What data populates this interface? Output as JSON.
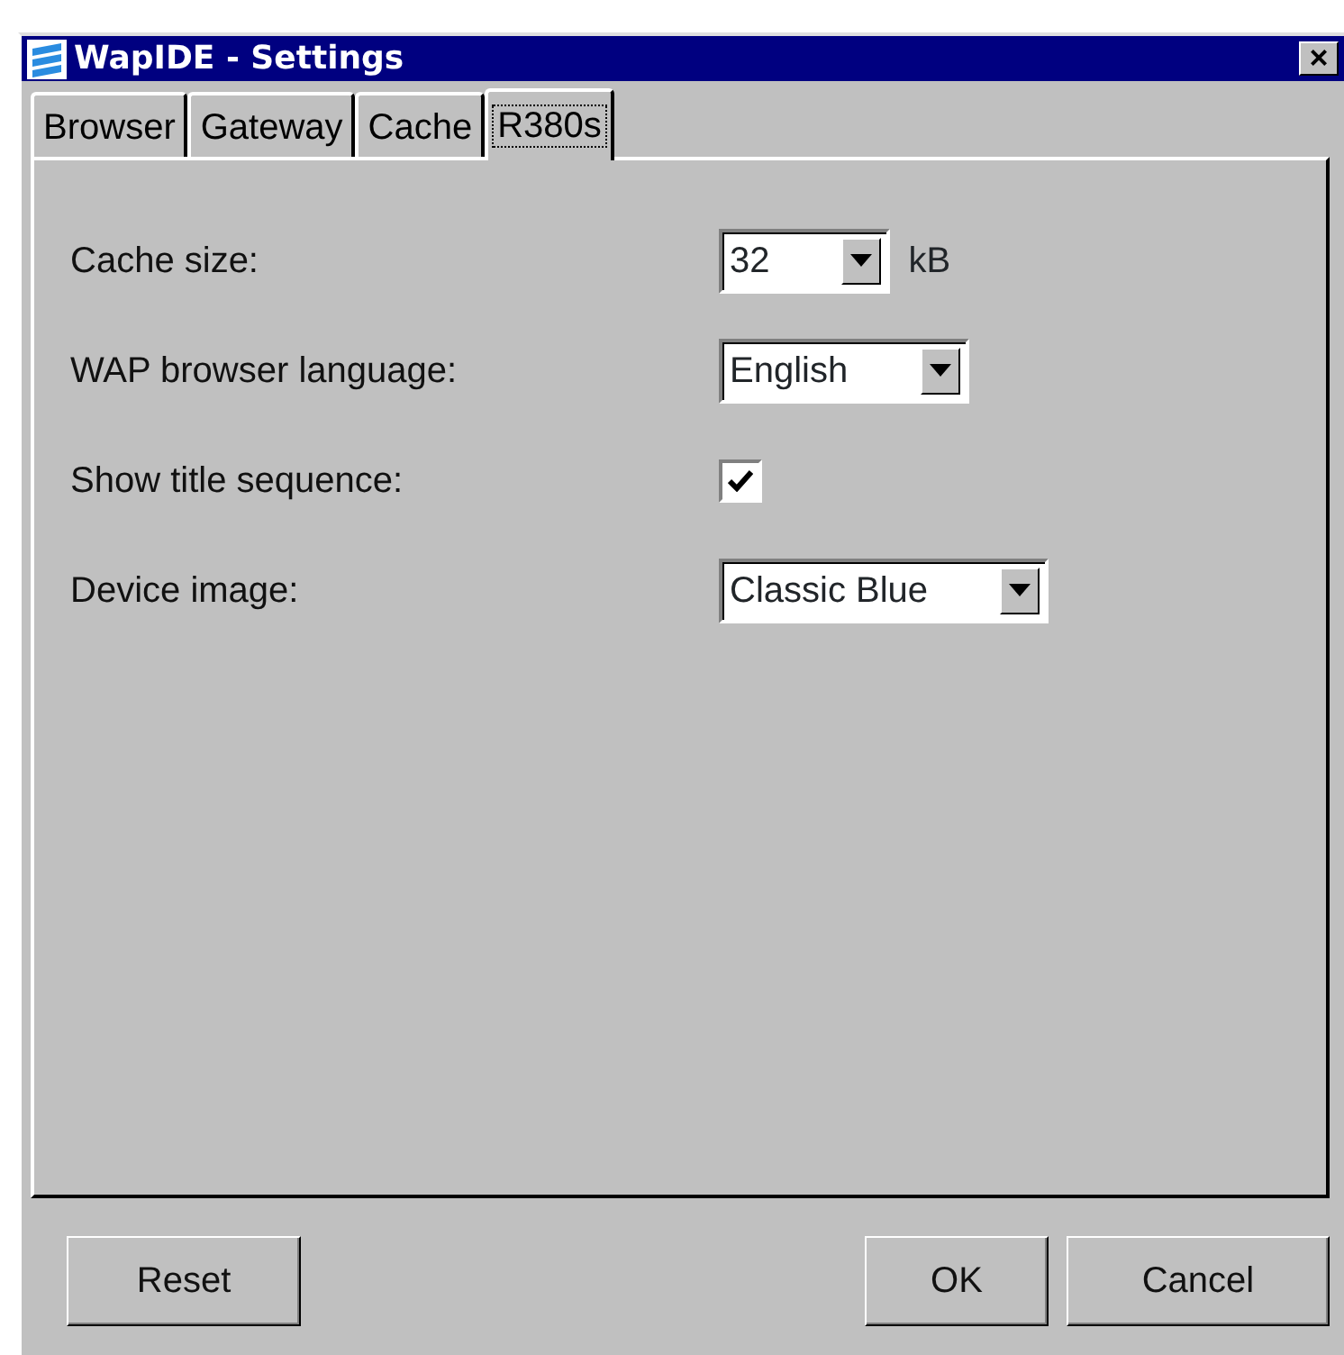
{
  "window": {
    "title": "WapIDE - Settings",
    "close": "×"
  },
  "tabs": [
    {
      "label": "Browser",
      "selected": false
    },
    {
      "label": "Gateway",
      "selected": false
    },
    {
      "label": "Cache",
      "selected": false
    },
    {
      "label": "R380s",
      "selected": true
    }
  ],
  "settings": [
    {
      "kind": "combo",
      "label": "Cache size:",
      "value": "32",
      "unit": "kB"
    },
    {
      "kind": "combo",
      "label": "WAP browser language:",
      "value": "English"
    },
    {
      "kind": "checkbox",
      "label": "Show title sequence:",
      "checked": true
    },
    {
      "kind": "combo",
      "label": "Device image:",
      "value": "Classic Blue"
    }
  ],
  "buttons_left": [
    "Reset"
  ],
  "buttons_right": [
    "OK",
    "Cancel"
  ]
}
